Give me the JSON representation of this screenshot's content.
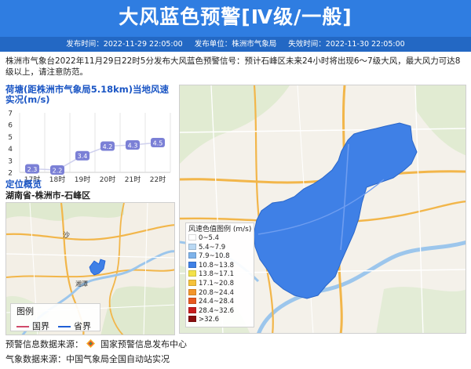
{
  "header": {
    "title": "大风蓝色预警[Ⅳ级/一般]",
    "publish_time": "发布时间：2022-11-29 22:05:00",
    "publisher": "发布单位：株洲市气象局",
    "expire_time": "失效时间：2022-11-30 22:05:00"
  },
  "description": "株洲市气象台2022年11月29日22时5分发布大风蓝色预警信号：预计石峰区未来24小时将出现6～7级大风，最大风力可达8级以上，请注意防范。",
  "station": {
    "title": "荷塘(距株洲市气象局5.18km)当地风速实况(m/s)"
  },
  "chart_data": {
    "type": "line",
    "title": "荷塘(距株洲市气象局5.18km)当地风速实况(m/s)",
    "categories": [
      "17时",
      "18时",
      "19时",
      "20时",
      "21时",
      "22时"
    ],
    "values": [
      2.3,
      2.2,
      3.4,
      4.2,
      4.3,
      4.5
    ],
    "y_ticks": [
      2,
      3,
      4,
      5,
      6,
      7
    ],
    "ylim": [
      2,
      7
    ],
    "grid": "vertical",
    "accent_color": "#7b80d6"
  },
  "location": {
    "title": "定位概览",
    "subtitle": "湖南省-株洲市-石峰区",
    "map_labels": [
      "沙",
      "湘潭"
    ],
    "legend": {
      "title": "图例",
      "items": [
        {
          "label": "国界",
          "color": "#d04a6a"
        },
        {
          "label": "省界",
          "color": "#1f5fd6"
        }
      ]
    }
  },
  "speed_legend": {
    "title": "风速色值图例 (m/s)",
    "items": [
      {
        "label": "0~5.4",
        "color": "#ffffff"
      },
      {
        "label": "5.4~7.9",
        "color": "#b9d8f3"
      },
      {
        "label": "7.9~10.8",
        "color": "#7fb3ea"
      },
      {
        "label": "10.8~13.8",
        "color": "#3f80e6"
      },
      {
        "label": "13.8~17.1",
        "color": "#f3e24a"
      },
      {
        "label": "17.1~20.8",
        "color": "#f5c23a"
      },
      {
        "label": "20.8~24.4",
        "color": "#f2962b"
      },
      {
        "label": "24.4~28.4",
        "color": "#e8591f"
      },
      {
        "label": "28.4~32.6",
        "color": "#c81e1e"
      },
      {
        "label": ">32.6",
        "color": "#8a0f0f"
      }
    ]
  },
  "footer": {
    "warning_source": "预警信息数据来源：",
    "warning_source_org": "国家预警信息发布中心",
    "weather_source": "气象数据来源：中国气象局全国自动站实况"
  },
  "colors": {
    "header_blue": "#2f7de1",
    "header_strip": "#2368c4",
    "title_blue": "#1a55c4",
    "warning_region": "#3f80e6"
  }
}
